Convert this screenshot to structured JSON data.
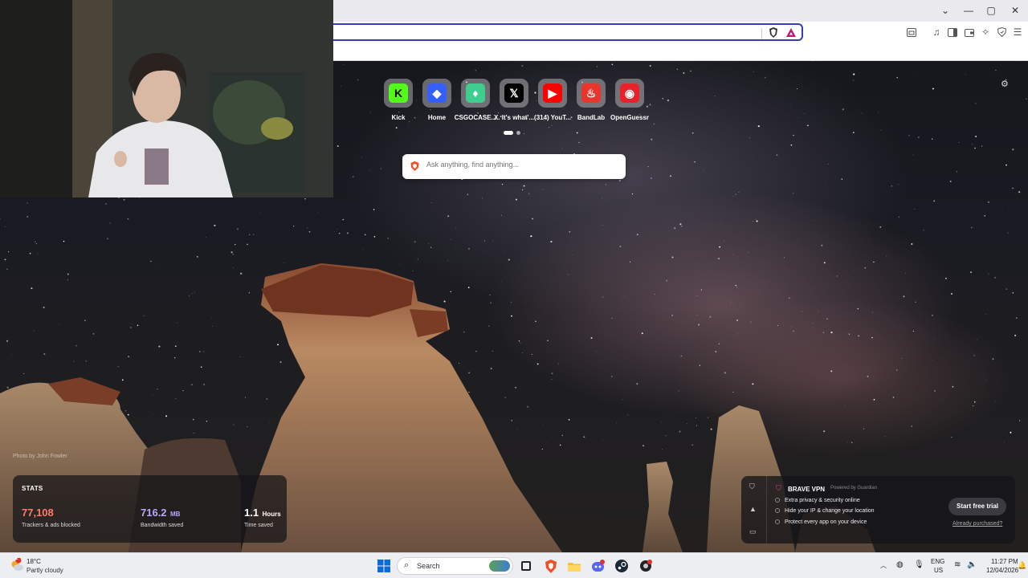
{
  "browser": {
    "window_controls": {
      "minimize": "—",
      "maximize": "▢",
      "close": "✕",
      "tabs_dropdown": "⌄"
    }
  },
  "new_tab": {
    "top_sites": [
      {
        "label": "Kick",
        "icon": "kick-icon",
        "glyph": "K",
        "color": "#53fc18",
        "text_color": "#000000"
      },
      {
        "label": "Home",
        "icon": "roblox-icon",
        "glyph": "◆",
        "color": "#335fff",
        "text_color": "#ffffff"
      },
      {
        "label": "CSGOCASE...",
        "icon": "csgocase-icon",
        "glyph": "♦",
        "color": "#3ecf8e",
        "text_color": "#ffffff"
      },
      {
        "label": "X. It's what'...",
        "icon": "x-icon",
        "glyph": "𝕏",
        "color": "#000000",
        "text_color": "#ffffff"
      },
      {
        "label": "(314) YouT...",
        "icon": "youtube-icon",
        "glyph": "▶",
        "color": "#ff0000",
        "text_color": "#ffffff"
      },
      {
        "label": "BandLab",
        "icon": "bandlab-icon",
        "glyph": "♨",
        "color": "#e9362d",
        "text_color": "#ffffff"
      },
      {
        "label": "OpenGuessr",
        "icon": "openguessr-icon",
        "glyph": "◉",
        "color": "#e8212b",
        "text_color": "#ffffff"
      }
    ],
    "search_placeholder": "Ask anything, find anything...",
    "photo_credit": "Photo by John Fowler"
  },
  "stats": {
    "title": "STATS",
    "items": [
      {
        "value": "77,108",
        "unit": "",
        "label": "Trackers & ads blocked",
        "color": "#ff7a6b"
      },
      {
        "value": "716.2",
        "unit": "MB",
        "label": "Bandwidth saved",
        "color": "#b9a6ff"
      },
      {
        "value": "1.1",
        "unit": "Hours",
        "label": "Time saved",
        "color": "#ffffff"
      }
    ]
  },
  "vpn": {
    "title": "BRAVE VPN",
    "powered_by": "Powered by  Guardian",
    "features": [
      "Extra privacy & security online",
      "Hide your IP & change your location",
      "Protect every app on your device"
    ],
    "cta": "Start free trial",
    "link": "Already purchased?"
  },
  "taskbar": {
    "weather": {
      "temp": "18°C",
      "desc": "Partly cloudy",
      "badge": "1"
    },
    "search_label": "Search",
    "lang": "ENG",
    "region": "US",
    "time": "11:27 PM",
    "date": "12/04/2026"
  }
}
